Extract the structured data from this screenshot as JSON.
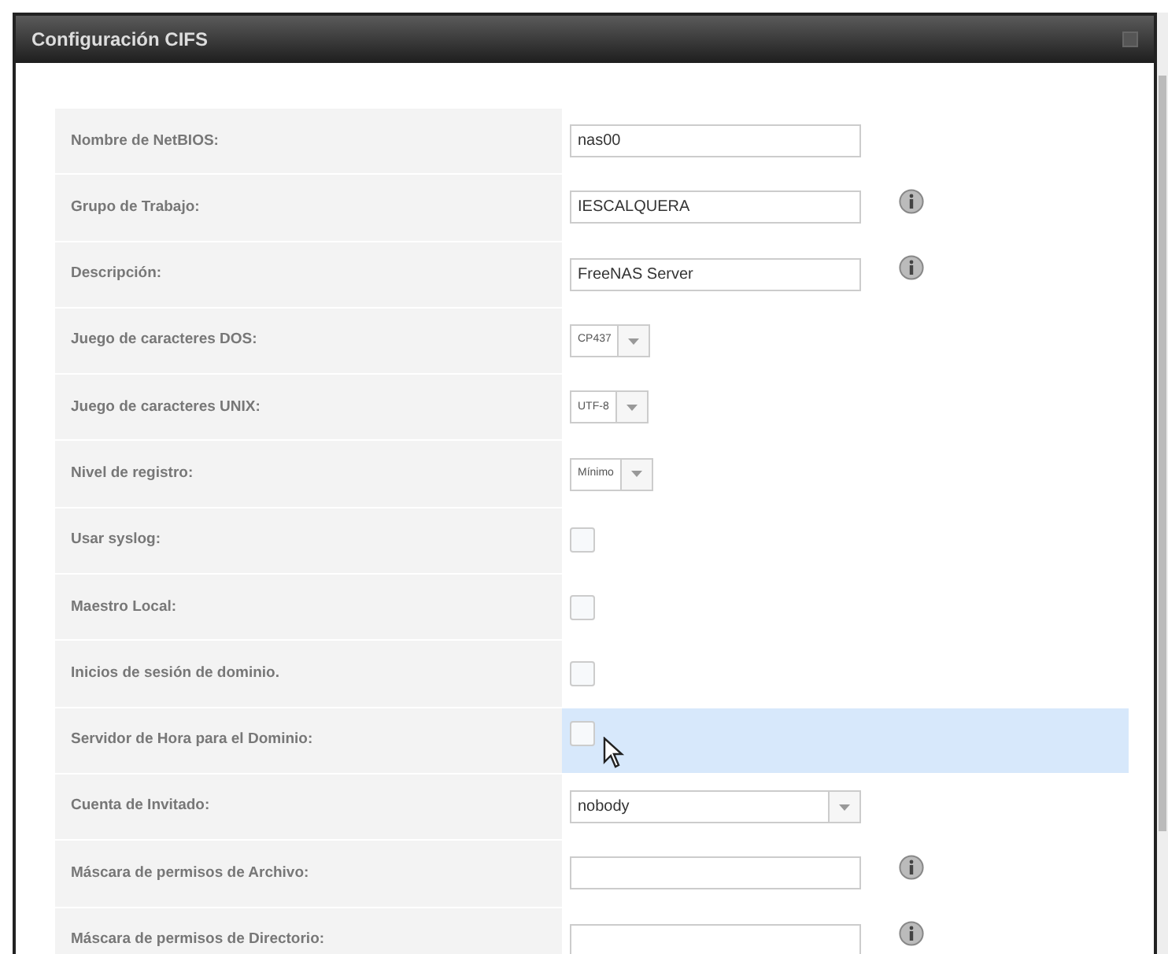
{
  "window": {
    "title": "Configuración CIFS"
  },
  "fields": [
    {
      "label": "Nombre de NetBIOS:",
      "kind": "text",
      "value": "nas00",
      "info": false,
      "highlighted": false
    },
    {
      "label": "Grupo de Trabajo:",
      "kind": "text",
      "value": "IESCALQUERA",
      "info": true,
      "highlighted": false
    },
    {
      "label": "Descripción:",
      "kind": "text",
      "value": "FreeNAS Server",
      "info": true,
      "highlighted": false
    },
    {
      "label": "Juego de caracteres DOS:",
      "kind": "select",
      "value": "CP437",
      "wide": false,
      "info": false,
      "highlighted": false
    },
    {
      "label": "Juego de caracteres UNIX:",
      "kind": "select",
      "value": "UTF-8",
      "wide": false,
      "info": false,
      "highlighted": false
    },
    {
      "label": "Nivel de registro:",
      "kind": "select",
      "value": "Mínimo",
      "wide": false,
      "info": false,
      "highlighted": false
    },
    {
      "label": "Usar syslog:",
      "kind": "checkbox",
      "checked": false,
      "info": false,
      "highlighted": false
    },
    {
      "label": "Maestro Local:",
      "kind": "checkbox",
      "checked": false,
      "info": false,
      "highlighted": false
    },
    {
      "label": "Inicios de sesión de dominio.",
      "kind": "checkbox",
      "checked": false,
      "info": false,
      "highlighted": false
    },
    {
      "label": "Servidor de Hora para el Dominio:",
      "kind": "checkbox",
      "checked": false,
      "info": false,
      "highlighted": true
    },
    {
      "label": "Cuenta de Invitado:",
      "kind": "select",
      "value": "nobody",
      "wide": true,
      "info": false,
      "highlighted": false
    },
    {
      "label": "Máscara de permisos de Archivo:",
      "kind": "text",
      "info": true,
      "highlighted": false
    },
    {
      "label": "Máscara de permisos de Directorio:",
      "kind": "text",
      "info": true,
      "highlighted": false
    }
  ]
}
